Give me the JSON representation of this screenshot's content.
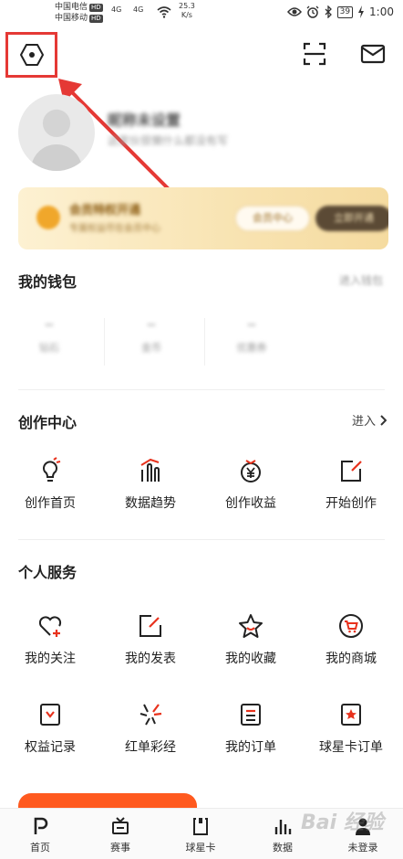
{
  "status_bar": {
    "carrier1": "中国电信",
    "carrier2": "中国移动",
    "hd": "HD",
    "signal": "4G",
    "speed_value": "25.3",
    "speed_unit": "K/s",
    "battery": "39",
    "time": "1:00"
  },
  "header": {
    "settings_icon": "hexagon-settings-icon",
    "scan_icon": "scan-icon",
    "mail_icon": "mail-icon"
  },
  "profile": {
    "nickname": "昵称未设置",
    "bio": "这家伙很懒什么都没有写"
  },
  "vip": {
    "title": "会员特权开通",
    "subtitle": "专属权益尽在会员中心",
    "button1": "会员中心",
    "button2": "立即开通"
  },
  "wallet": {
    "title": "我的钱包",
    "link": "进入钱包",
    "items": [
      {
        "value": "--",
        "label": "钻石"
      },
      {
        "value": "--",
        "label": "金币"
      },
      {
        "value": "--",
        "label": "优惠券"
      }
    ]
  },
  "creator": {
    "title": "创作中心",
    "enter": "进入",
    "items": [
      {
        "label": "创作首页",
        "icon": "bulb-icon"
      },
      {
        "label": "数据趋势",
        "icon": "trend-chart-icon"
      },
      {
        "label": "创作收益",
        "icon": "yen-coin-icon"
      },
      {
        "label": "开始创作",
        "icon": "edit-note-icon"
      }
    ]
  },
  "services": {
    "title": "个人服务",
    "row1": [
      {
        "label": "我的关注",
        "icon": "heart-plus-icon"
      },
      {
        "label": "我的发表",
        "icon": "publish-icon"
      },
      {
        "label": "我的收藏",
        "icon": "star-icon"
      },
      {
        "label": "我的商城",
        "icon": "cart-icon"
      }
    ],
    "row2": [
      {
        "label": "权益记录",
        "icon": "benefit-record-icon"
      },
      {
        "label": "红单彩经",
        "icon": "burst-icon"
      },
      {
        "label": "我的订单",
        "icon": "order-icon"
      },
      {
        "label": "球星卡订单",
        "icon": "card-order-icon"
      }
    ]
  },
  "tabs": [
    {
      "label": "首页",
      "icon": "home-icon"
    },
    {
      "label": "赛事",
      "icon": "tv-icon"
    },
    {
      "label": "球星卡",
      "icon": "card-icon"
    },
    {
      "label": "数据",
      "icon": "bar-chart-icon"
    },
    {
      "label": "未登录",
      "icon": "user-icon"
    }
  ],
  "watermark": "Bai 经验",
  "colors": {
    "accent": "#e53935",
    "highlight_box": "#e53935",
    "icon_dark": "#222222",
    "icon_red": "#e8321d",
    "vip_gold": "#f8e3b1"
  }
}
